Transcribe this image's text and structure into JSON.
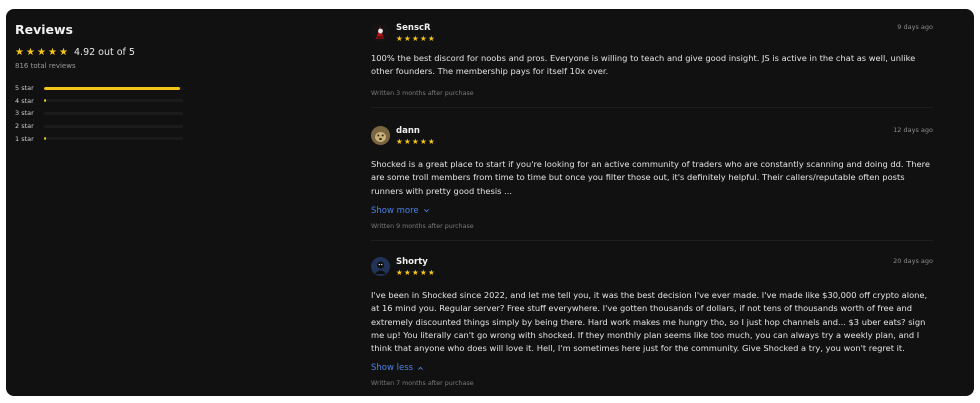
{
  "summary": {
    "title": "Reviews",
    "rating_text": "4.92 out of 5",
    "total_reviews": "816 total reviews",
    "distribution": [
      {
        "label": "5 star",
        "fraction": 0.98
      },
      {
        "label": "4 star",
        "fraction": 0.012
      },
      {
        "label": "3 star",
        "fraction": 0.0
      },
      {
        "label": "2 star",
        "fraction": 0.0
      },
      {
        "label": "1 star",
        "fraction": 0.012
      }
    ],
    "star_color": "#f5c518",
    "bar_color": "#f2c518"
  },
  "reviews": [
    {
      "name": "SenscR",
      "date": "9 days ago",
      "stars": 5,
      "avatar_icon": "robot-red-avatar",
      "body": "100% the best discord for noobs and pros. Everyone is willing to teach and give good insight. JS is active in the chat as well, unlike other founders. The membership pays for itself 10x over.",
      "written": "Written 3 months after purchase"
    },
    {
      "name": "dann",
      "date": "12 days ago",
      "stars": 5,
      "avatar_icon": "dog-avatar",
      "body": "Shocked is a great place to start if you're looking for an active community of traders who are constantly scanning and doing dd. There are some troll members from time to time but once you filter those out, it's definitely helpful. Their callers/reputable often posts runners with pretty good thesis ...",
      "toggle": "Show more",
      "written": "Written 9 months after purchase"
    },
    {
      "name": "Shorty",
      "date": "20 days ago",
      "stars": 5,
      "avatar_icon": "character-blue-avatar",
      "body": "I've been in Shocked since 2022, and let me tell you, it was the best decision I've ever made. I've made like $30,000 off crypto alone, at 16 mind you. Regular server? Free stuff everywhere. I've gotten thousands of dollars, if not tens of thousands worth of free and extremely discounted things simply by being there. Hard work makes me hungry tho, so I just hop channels and... $3 uber eats? sign me up! You literally can't go wrong with shocked. If they monthly plan seems like too much, you can always try a weekly plan, and I think that anyone who does will love it. Hell, I'm sometimes here just for the community. Give Shocked a try, you won't regret it.",
      "toggle": "Show less",
      "written": "Written 7 months after purchase"
    }
  ]
}
